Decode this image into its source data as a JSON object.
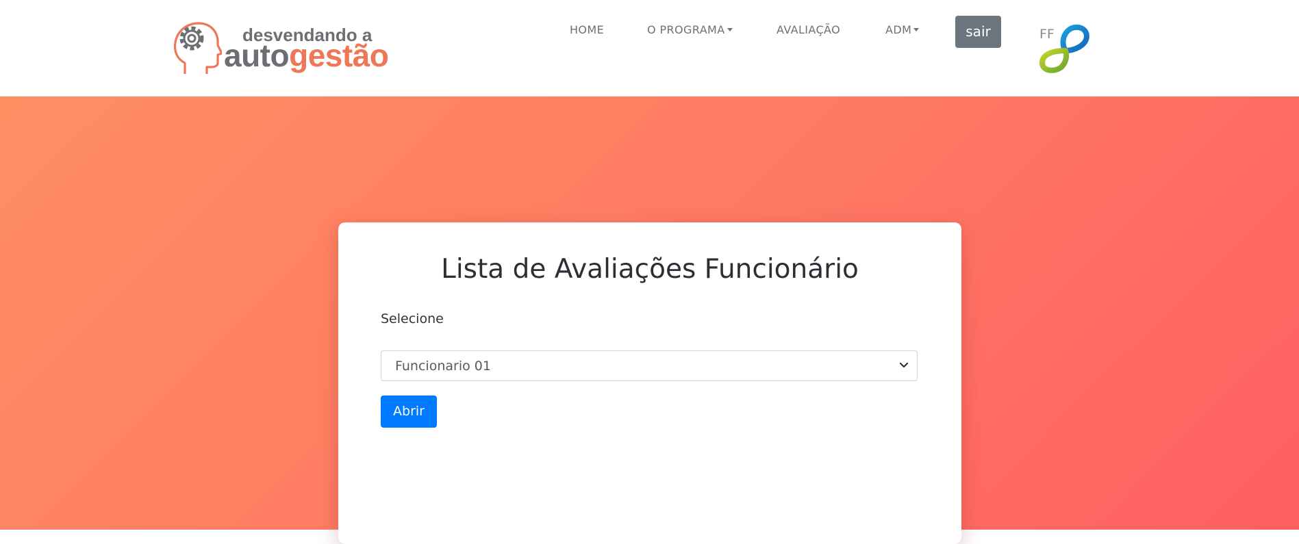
{
  "logo": {
    "line1": "desvendando a",
    "line2_part1": "auto",
    "line2_part2": "gestão",
    "brand_gray": "#6b6e73",
    "brand_orange": "#ef7656"
  },
  "nav": {
    "items": [
      {
        "label": "HOME",
        "dropdown": false
      },
      {
        "label": "O PROGRAMA",
        "dropdown": true
      },
      {
        "label": "AVALIAÇÃO",
        "dropdown": false
      },
      {
        "label": "ADM",
        "dropdown": true
      }
    ],
    "logout_label": "sair"
  },
  "partner_logo": {
    "text": "FF",
    "icon": "infinity-logo-icon"
  },
  "hero": {
    "gradient_start": "#ff8e63",
    "gradient_end": "#ff5e62"
  },
  "card": {
    "title": "Lista de Avaliações Funcionário",
    "select_label": "Selecione",
    "select_value": "Funcionario 01",
    "submit_label": "Abrir",
    "button_color": "#007bff"
  }
}
